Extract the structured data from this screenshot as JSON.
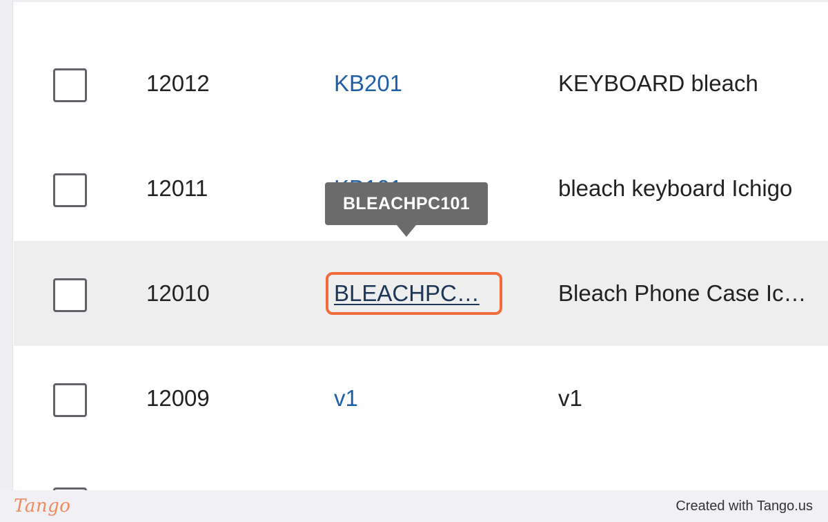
{
  "table": {
    "rows": [
      {
        "id": "12012",
        "code": "KB201",
        "name": "KEYBOARD bleach"
      },
      {
        "id": "12011",
        "code": "KB101",
        "name": "bleach keyboard Ichigo"
      },
      {
        "id": "12010",
        "code": "BLEACHPC…",
        "name": "Bleach Phone Case Ic…"
      },
      {
        "id": "12009",
        "code": "v1",
        "name": "v1"
      }
    ]
  },
  "tooltip": {
    "text": "BLEACHPC101"
  },
  "footer": {
    "logo_text": "Tango",
    "credit": "Created with Tango.us"
  },
  "colors": {
    "link": "#1f5fa8",
    "highlight": "#f26b3a",
    "hover_row": "#eeeeee",
    "tooltip_bg": "#6b6b6b"
  }
}
